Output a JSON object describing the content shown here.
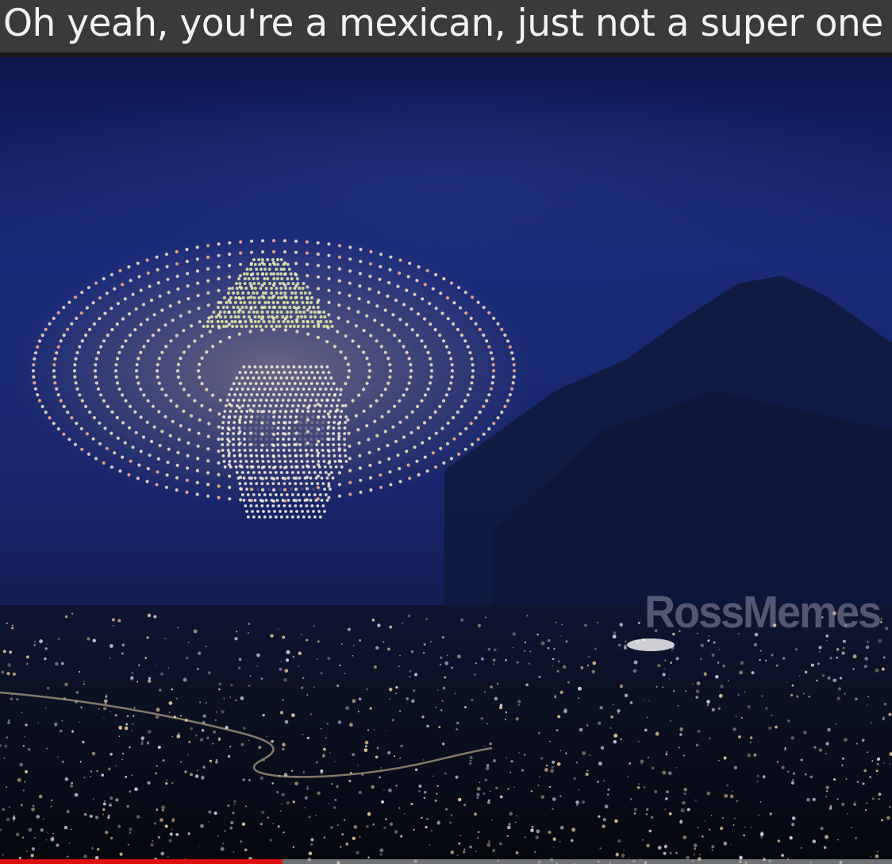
{
  "caption": {
    "text": "Oh yeah, you're a mexican, just not a super one"
  },
  "watermark": {
    "text": "RossMemes"
  },
  "video": {
    "progress": 0.317,
    "progress_color": "#e01010"
  },
  "colors": {
    "sky_top": "#0e1a55",
    "sky_mid": "#1b2c7a",
    "mountain": "#0f1a3f",
    "city_ground": "#090d1c",
    "drone_light": "#ffe9b8"
  }
}
